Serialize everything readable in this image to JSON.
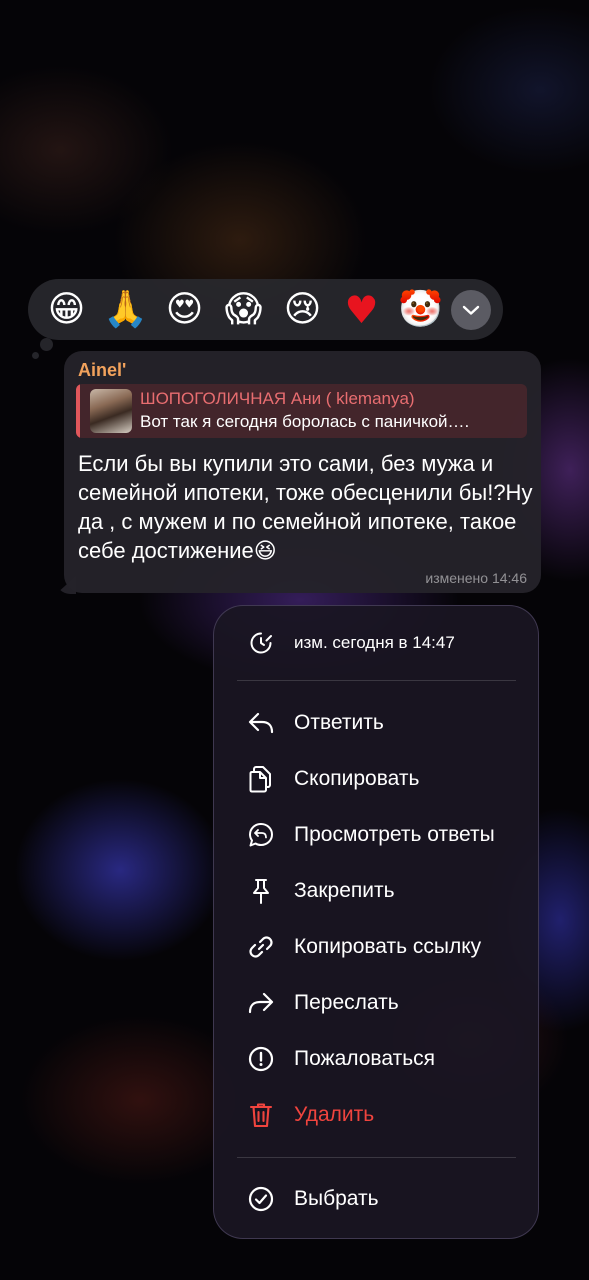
{
  "reactions": {
    "items": [
      "😁",
      "🙏",
      "😍",
      "😱",
      "😢",
      "♥",
      "🤡"
    ],
    "expand_icon": "chevron-down-icon"
  },
  "message": {
    "sender": "Ainel'",
    "quote": {
      "author": "ШОПОГОЛИЧНАЯ Ани ( klemanya)",
      "text": "Вот так я сегодня боролась с паничкой…."
    },
    "text": "Если бы вы купили это сами, без мужа и семейной ипотеки, тоже обесценили бы!?Ну да , с мужем и по семейной ипотеке, такое себе достижение😆",
    "time": "изменено 14:46"
  },
  "menu": {
    "edited_info": "изм. сегодня в 14:47",
    "items": [
      {
        "label": "Ответить",
        "icon": "reply-icon"
      },
      {
        "label": "Скопировать",
        "icon": "copy-icon"
      },
      {
        "label": "Просмотреть ответы",
        "icon": "view-replies-icon"
      },
      {
        "label": "Закрепить",
        "icon": "pin-icon"
      },
      {
        "label": "Копировать ссылку",
        "icon": "link-icon"
      },
      {
        "label": "Переслать",
        "icon": "forward-icon"
      },
      {
        "label": "Пожаловаться",
        "icon": "report-icon"
      },
      {
        "label": "Удалить",
        "icon": "trash-icon"
      }
    ],
    "select": {
      "label": "Выбрать",
      "icon": "checkmark-circle-icon"
    }
  },
  "colors": {
    "accent_name": "#f2a25c",
    "quote_accent": "#e86d70",
    "danger": "#f0443e"
  }
}
